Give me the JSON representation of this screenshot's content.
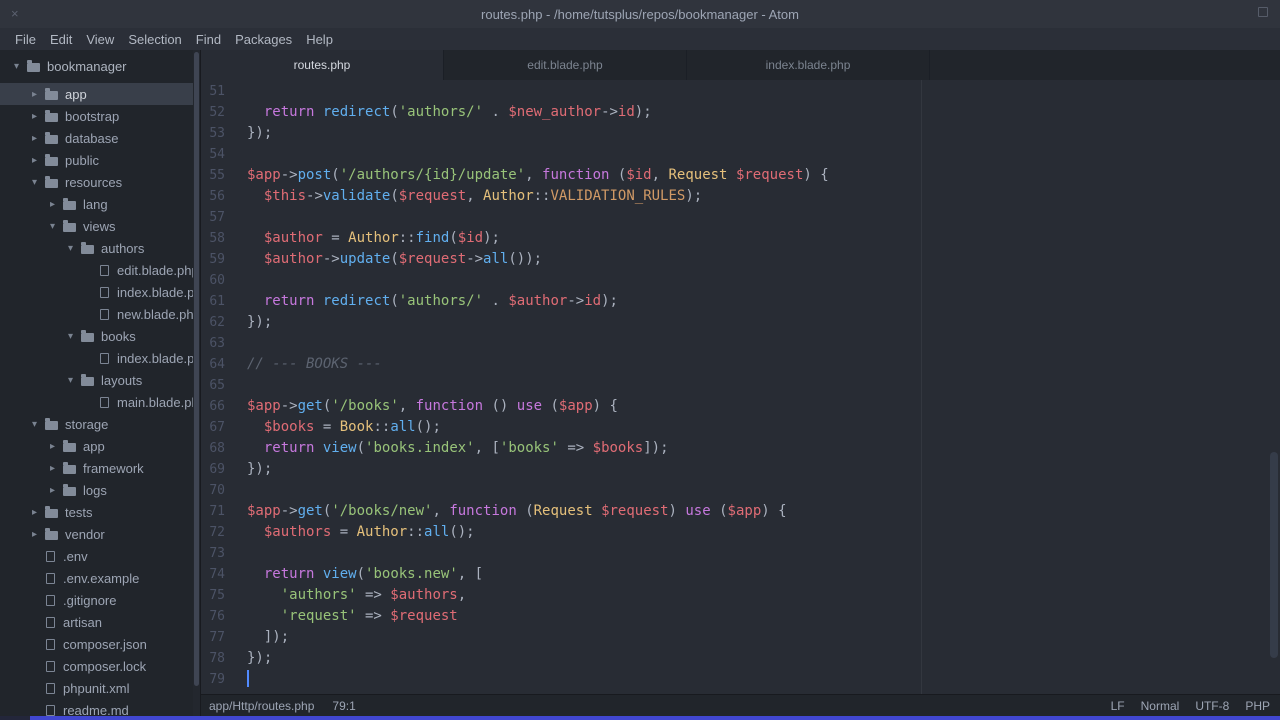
{
  "window": {
    "title": "routes.php - /home/tutsplus/repos/bookmanager - Atom",
    "close_glyph": "×"
  },
  "menu": {
    "items": [
      "File",
      "Edit",
      "View",
      "Selection",
      "Find",
      "Packages",
      "Help"
    ]
  },
  "tree": {
    "items": [
      {
        "label": "bookmanager",
        "type": "folder",
        "level": 0,
        "expanded": true,
        "root": true
      },
      {
        "label": "app",
        "type": "folder",
        "level": 1,
        "expanded": false,
        "selected": true
      },
      {
        "label": "bootstrap",
        "type": "folder",
        "level": 1,
        "expanded": false
      },
      {
        "label": "database",
        "type": "folder",
        "level": 1,
        "expanded": false
      },
      {
        "label": "public",
        "type": "folder",
        "level": 1,
        "expanded": false
      },
      {
        "label": "resources",
        "type": "folder",
        "level": 1,
        "expanded": true
      },
      {
        "label": "lang",
        "type": "folder",
        "level": 2,
        "expanded": false
      },
      {
        "label": "views",
        "type": "folder",
        "level": 2,
        "expanded": true
      },
      {
        "label": "authors",
        "type": "folder",
        "level": 3,
        "expanded": true
      },
      {
        "label": "edit.blade.php",
        "type": "file",
        "level": 4
      },
      {
        "label": "index.blade.php",
        "type": "file",
        "level": 4
      },
      {
        "label": "new.blade.php",
        "type": "file",
        "level": 4
      },
      {
        "label": "books",
        "type": "folder",
        "level": 3,
        "expanded": true
      },
      {
        "label": "index.blade.php",
        "type": "file",
        "level": 4
      },
      {
        "label": "layouts",
        "type": "folder",
        "level": 3,
        "expanded": true
      },
      {
        "label": "main.blade.php",
        "type": "file",
        "level": 4
      },
      {
        "label": "storage",
        "type": "folder",
        "level": 1,
        "expanded": true
      },
      {
        "label": "app",
        "type": "folder",
        "level": 2,
        "expanded": false
      },
      {
        "label": "framework",
        "type": "folder",
        "level": 2,
        "expanded": false
      },
      {
        "label": "logs",
        "type": "folder",
        "level": 2,
        "expanded": false
      },
      {
        "label": "tests",
        "type": "folder",
        "level": 1,
        "expanded": false
      },
      {
        "label": "vendor",
        "type": "folder",
        "level": 1,
        "expanded": false
      },
      {
        "label": ".env",
        "type": "file",
        "level": 1
      },
      {
        "label": ".env.example",
        "type": "file",
        "level": 1
      },
      {
        "label": ".gitignore",
        "type": "file",
        "level": 1
      },
      {
        "label": "artisan",
        "type": "file",
        "level": 1
      },
      {
        "label": "composer.json",
        "type": "file",
        "level": 1
      },
      {
        "label": "composer.lock",
        "type": "file",
        "level": 1
      },
      {
        "label": "phpunit.xml",
        "type": "file",
        "level": 1
      },
      {
        "label": "readme.md",
        "type": "file",
        "level": 1
      }
    ]
  },
  "tabs": [
    {
      "label": "routes.php",
      "active": true
    },
    {
      "label": "edit.blade.php",
      "active": false
    },
    {
      "label": "index.blade.php",
      "active": false
    }
  ],
  "editor": {
    "lines": [
      {
        "n": 51,
        "t": []
      },
      {
        "n": 52,
        "t": [
          [
            "  ",
            "p"
          ],
          [
            "return",
            "k"
          ],
          [
            " ",
            "p"
          ],
          [
            "redirect",
            "f"
          ],
          [
            "(",
            "p"
          ],
          [
            "'authors/'",
            "s"
          ],
          [
            " . ",
            "p"
          ],
          [
            "$new_author",
            "v"
          ],
          [
            "->",
            "p"
          ],
          [
            "id",
            "v"
          ],
          [
            ");",
            "p"
          ]
        ]
      },
      {
        "n": 53,
        "t": [
          [
            "});",
            "p"
          ]
        ]
      },
      {
        "n": 54,
        "t": []
      },
      {
        "n": 55,
        "t": [
          [
            "$app",
            "v"
          ],
          [
            "->",
            "p"
          ],
          [
            "post",
            "f"
          ],
          [
            "(",
            "p"
          ],
          [
            "'/authors/{id}/update'",
            "s"
          ],
          [
            ", ",
            "p"
          ],
          [
            "function",
            "k"
          ],
          [
            " (",
            "p"
          ],
          [
            "$id",
            "v"
          ],
          [
            ", ",
            "p"
          ],
          [
            "Request",
            "c"
          ],
          [
            " ",
            "p"
          ],
          [
            "$request",
            "v"
          ],
          [
            ") {",
            "p"
          ]
        ]
      },
      {
        "n": 56,
        "t": [
          [
            "  ",
            "p"
          ],
          [
            "$this",
            "v"
          ],
          [
            "->",
            "p"
          ],
          [
            "validate",
            "f"
          ],
          [
            "(",
            "p"
          ],
          [
            "$request",
            "v"
          ],
          [
            ", ",
            "p"
          ],
          [
            "Author",
            "c"
          ],
          [
            "::",
            "p"
          ],
          [
            "VALIDATION_RULES",
            "o"
          ],
          [
            ");",
            "p"
          ]
        ]
      },
      {
        "n": 57,
        "t": []
      },
      {
        "n": 58,
        "t": [
          [
            "  ",
            "p"
          ],
          [
            "$author",
            "v"
          ],
          [
            " = ",
            "p"
          ],
          [
            "Author",
            "c"
          ],
          [
            "::",
            "p"
          ],
          [
            "find",
            "f"
          ],
          [
            "(",
            "p"
          ],
          [
            "$id",
            "v"
          ],
          [
            ");",
            "p"
          ]
        ]
      },
      {
        "n": 59,
        "t": [
          [
            "  ",
            "p"
          ],
          [
            "$author",
            "v"
          ],
          [
            "->",
            "p"
          ],
          [
            "update",
            "f"
          ],
          [
            "(",
            "p"
          ],
          [
            "$request",
            "v"
          ],
          [
            "->",
            "p"
          ],
          [
            "all",
            "f"
          ],
          [
            "());",
            "p"
          ]
        ]
      },
      {
        "n": 60,
        "t": []
      },
      {
        "n": 61,
        "t": [
          [
            "  ",
            "p"
          ],
          [
            "return",
            "k"
          ],
          [
            " ",
            "p"
          ],
          [
            "redirect",
            "f"
          ],
          [
            "(",
            "p"
          ],
          [
            "'authors/'",
            "s"
          ],
          [
            " . ",
            "p"
          ],
          [
            "$author",
            "v"
          ],
          [
            "->",
            "p"
          ],
          [
            "id",
            "v"
          ],
          [
            ");",
            "p"
          ]
        ]
      },
      {
        "n": 62,
        "t": [
          [
            "});",
            "p"
          ]
        ]
      },
      {
        "n": 63,
        "t": []
      },
      {
        "n": 64,
        "t": [
          [
            "// --- BOOKS ---",
            "m"
          ]
        ]
      },
      {
        "n": 65,
        "t": []
      },
      {
        "n": 66,
        "t": [
          [
            "$app",
            "v"
          ],
          [
            "->",
            "p"
          ],
          [
            "get",
            "f"
          ],
          [
            "(",
            "p"
          ],
          [
            "'/books'",
            "s"
          ],
          [
            ", ",
            "p"
          ],
          [
            "function",
            "k"
          ],
          [
            " () ",
            "p"
          ],
          [
            "use",
            "k"
          ],
          [
            " (",
            "p"
          ],
          [
            "$app",
            "v"
          ],
          [
            ") {",
            "p"
          ]
        ]
      },
      {
        "n": 67,
        "t": [
          [
            "  ",
            "p"
          ],
          [
            "$books",
            "v"
          ],
          [
            " = ",
            "p"
          ],
          [
            "Book",
            "c"
          ],
          [
            "::",
            "p"
          ],
          [
            "all",
            "f"
          ],
          [
            "();",
            "p"
          ]
        ]
      },
      {
        "n": 68,
        "t": [
          [
            "  ",
            "p"
          ],
          [
            "return",
            "k"
          ],
          [
            " ",
            "p"
          ],
          [
            "view",
            "f"
          ],
          [
            "(",
            "p"
          ],
          [
            "'books.index'",
            "s"
          ],
          [
            ", [",
            "p"
          ],
          [
            "'books'",
            "s"
          ],
          [
            " => ",
            "p"
          ],
          [
            "$books",
            "v"
          ],
          [
            "]);",
            "p"
          ]
        ]
      },
      {
        "n": 69,
        "t": [
          [
            "});",
            "p"
          ]
        ]
      },
      {
        "n": 70,
        "t": []
      },
      {
        "n": 71,
        "t": [
          [
            "$app",
            "v"
          ],
          [
            "->",
            "p"
          ],
          [
            "get",
            "f"
          ],
          [
            "(",
            "p"
          ],
          [
            "'/books/new'",
            "s"
          ],
          [
            ", ",
            "p"
          ],
          [
            "function",
            "k"
          ],
          [
            " (",
            "p"
          ],
          [
            "Request",
            "c"
          ],
          [
            " ",
            "p"
          ],
          [
            "$request",
            "v"
          ],
          [
            ") ",
            "p"
          ],
          [
            "use",
            "k"
          ],
          [
            " (",
            "p"
          ],
          [
            "$app",
            "v"
          ],
          [
            ") {",
            "p"
          ]
        ]
      },
      {
        "n": 72,
        "t": [
          [
            "  ",
            "p"
          ],
          [
            "$authors",
            "v"
          ],
          [
            " = ",
            "p"
          ],
          [
            "Author",
            "c"
          ],
          [
            "::",
            "p"
          ],
          [
            "all",
            "f"
          ],
          [
            "();",
            "p"
          ]
        ]
      },
      {
        "n": 73,
        "t": []
      },
      {
        "n": 74,
        "t": [
          [
            "  ",
            "p"
          ],
          [
            "return",
            "k"
          ],
          [
            " ",
            "p"
          ],
          [
            "view",
            "f"
          ],
          [
            "(",
            "p"
          ],
          [
            "'books.new'",
            "s"
          ],
          [
            ", [",
            "p"
          ]
        ]
      },
      {
        "n": 75,
        "t": [
          [
            "    ",
            "p"
          ],
          [
            "'authors'",
            "s"
          ],
          [
            " => ",
            "p"
          ],
          [
            "$authors",
            "v"
          ],
          [
            ",",
            "p"
          ]
        ]
      },
      {
        "n": 76,
        "t": [
          [
            "    ",
            "p"
          ],
          [
            "'request'",
            "s"
          ],
          [
            " => ",
            "p"
          ],
          [
            "$request",
            "v"
          ]
        ]
      },
      {
        "n": 77,
        "t": [
          [
            "  ]);",
            "p"
          ]
        ]
      },
      {
        "n": 78,
        "t": [
          [
            "});",
            "p"
          ]
        ]
      },
      {
        "n": 79,
        "t": []
      }
    ]
  },
  "status": {
    "left": [
      {
        "name": "file-path",
        "text": "app/Http/routes.php",
        "interactable": false
      },
      {
        "name": "cursor-position",
        "text": "79:1",
        "interactable": true
      }
    ],
    "right": [
      {
        "name": "line-ending",
        "text": "LF",
        "interactable": true
      },
      {
        "name": "vim-mode",
        "text": "Normal",
        "interactable": false
      },
      {
        "name": "encoding",
        "text": "UTF-8",
        "interactable": true
      },
      {
        "name": "grammar",
        "text": "PHP",
        "interactable": true
      }
    ]
  },
  "colors": {
    "keyword": "#c678dd",
    "function": "#61afef",
    "string": "#98c379",
    "variable": "#e06c75",
    "classname": "#e5c07b",
    "constant": "#d19a66",
    "comment": "#5c6370",
    "plain": "#abb2bf",
    "editor-bg": "#282c34",
    "panel-bg": "#21252b",
    "accent": "#528bff"
  }
}
